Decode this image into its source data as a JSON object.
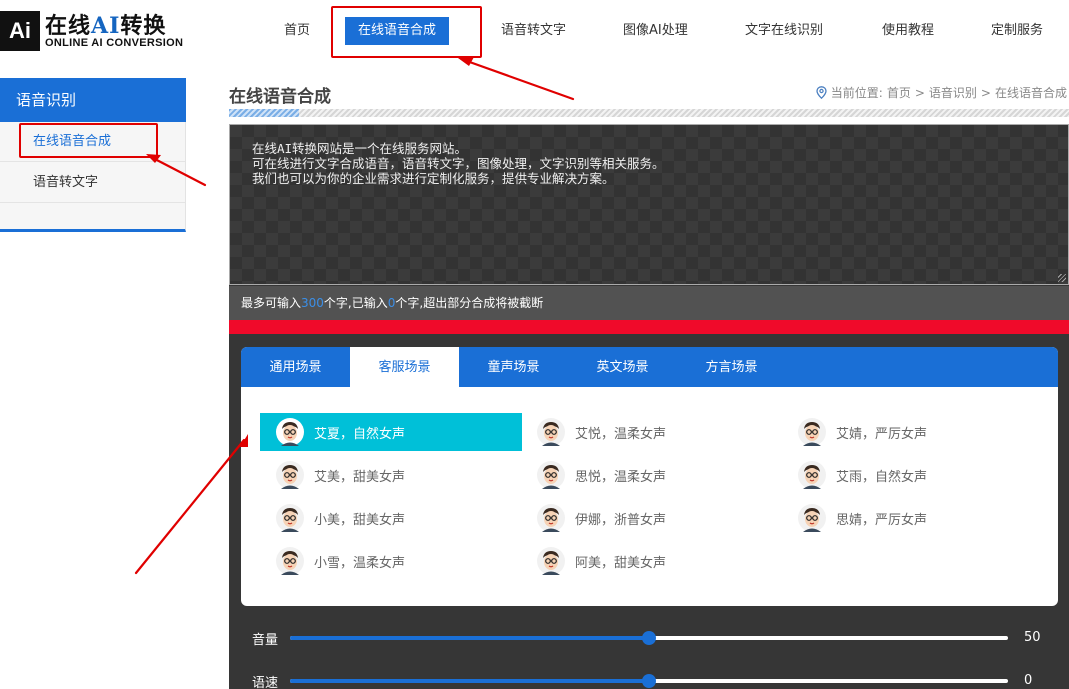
{
  "logo": {
    "badge": "Ai",
    "title_pre": "在线",
    "title_ai": "AI",
    "title_post": "转换",
    "subtitle": "ONLINE AI CONVERSION"
  },
  "nav": [
    {
      "label": "首页"
    },
    {
      "label": "在线语音合成",
      "active": true
    },
    {
      "label": "语音转文字"
    },
    {
      "label": "图像AI处理"
    },
    {
      "label": "文字在线识别"
    },
    {
      "label": "使用教程"
    },
    {
      "label": "定制服务"
    }
  ],
  "sidebar": {
    "title": "语音识别",
    "items": [
      {
        "label": "在线语音合成",
        "active": true
      },
      {
        "label": "语音转文字"
      }
    ]
  },
  "page": {
    "title": "在线语音合成"
  },
  "breadcrumb": {
    "prefix": "当前位置:",
    "items": [
      "首页",
      "语音识别",
      "在线语音合成"
    ],
    "sep": ">"
  },
  "editor": {
    "text": "在线AI转换网站是一个在线服务网站。\n可在线进行文字合成语音，语音转文字，图像处理，文字识别等相关服务。\n我们也可以为你的企业需求进行定制化服务，提供专业解决方案。"
  },
  "counter": {
    "pre": "最多可输入",
    "max": "300",
    "mid": "个字,已输入",
    "count": "0",
    "post": "个字,超出部分合成将被截断"
  },
  "scene_tabs": [
    {
      "label": "通用场景"
    },
    {
      "label": "客服场景",
      "active": true
    },
    {
      "label": "童声场景"
    },
    {
      "label": "英文场景"
    },
    {
      "label": "方言场景"
    }
  ],
  "voices": [
    {
      "label": "艾夏，自然女声",
      "selected": true
    },
    {
      "label": "艾悦，温柔女声"
    },
    {
      "label": "艾婧，严厉女声"
    },
    {
      "label": "艾美，甜美女声"
    },
    {
      "label": "思悦，温柔女声"
    },
    {
      "label": "艾雨，自然女声"
    },
    {
      "label": "小美，甜美女声"
    },
    {
      "label": "伊娜，浙普女声"
    },
    {
      "label": "思婧，严厉女声"
    },
    {
      "label": "小雪，温柔女声"
    },
    {
      "label": "阿美，甜美女声"
    }
  ],
  "sliders": [
    {
      "label": "音量",
      "value": "50",
      "fraction": 0.5
    },
    {
      "label": "语速",
      "value": "0",
      "fraction": 0.5
    }
  ],
  "colors": {
    "brand": "#1a6fd6",
    "selected_voice": "#00c0d8",
    "annotation": "#e00000"
  }
}
